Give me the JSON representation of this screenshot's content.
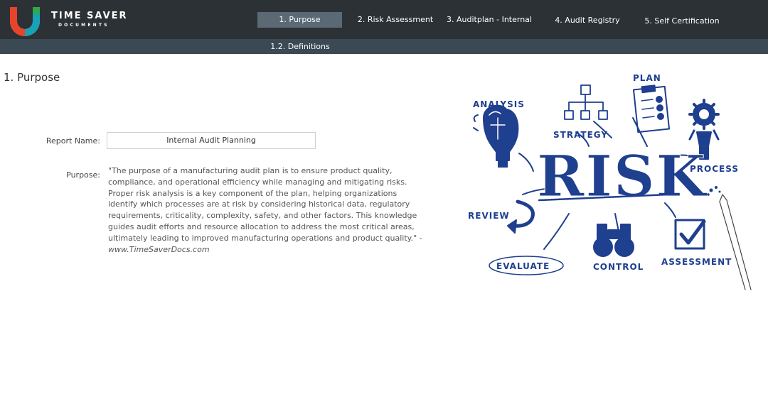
{
  "brand": {
    "name": "TIME SAVER",
    "sub": "DOCUMENTS"
  },
  "nav": {
    "items": [
      {
        "label": "1. Purpose",
        "active": true
      },
      {
        "label": "2. Risk Assessment",
        "active": false
      },
      {
        "label": "3. Auditplan - Internal",
        "active": false
      },
      {
        "label": "4. Audit Registry",
        "active": false
      },
      {
        "label": "5. Self Certification",
        "active": false
      }
    ],
    "subitems": [
      {
        "label": "1.2. Definitions"
      }
    ]
  },
  "page": {
    "title": "1. Purpose"
  },
  "form": {
    "report_name_label": "Report Name:",
    "report_name_value": "Internal Audit Planning",
    "purpose_label": "Purpose:",
    "purpose_text": "\"The purpose of a manufacturing audit plan is to ensure product quality, compliance, and operational efficiency while managing and mitigating risks. Proper risk analysis is a key component of the plan, helping organizations identify which processes are at risk by considering historical data, regulatory requirements, criticality, complexity, safety, and other factors. This knowledge guides audit efforts and resource allocation to address the most critical areas, ultimately leading to improved manufacturing operations and product quality.\" - ",
    "purpose_source": "www.TimeSaverDocs.com"
  },
  "illustration": {
    "main_word": "RISK",
    "labels": {
      "analysis": "ANALYSIS",
      "plan": "PLAN",
      "strategy": "STRATEGY",
      "process": "PROCESS",
      "review": "REVIEW",
      "evaluate": "EVALUATE",
      "control": "CONTROL",
      "assessment": "ASSESSMENT"
    }
  },
  "colors": {
    "topbar": "#2c3136",
    "nav_active": "#5b6975",
    "subbar": "#3b4954",
    "illustration_blue": "#1f3f8f"
  }
}
